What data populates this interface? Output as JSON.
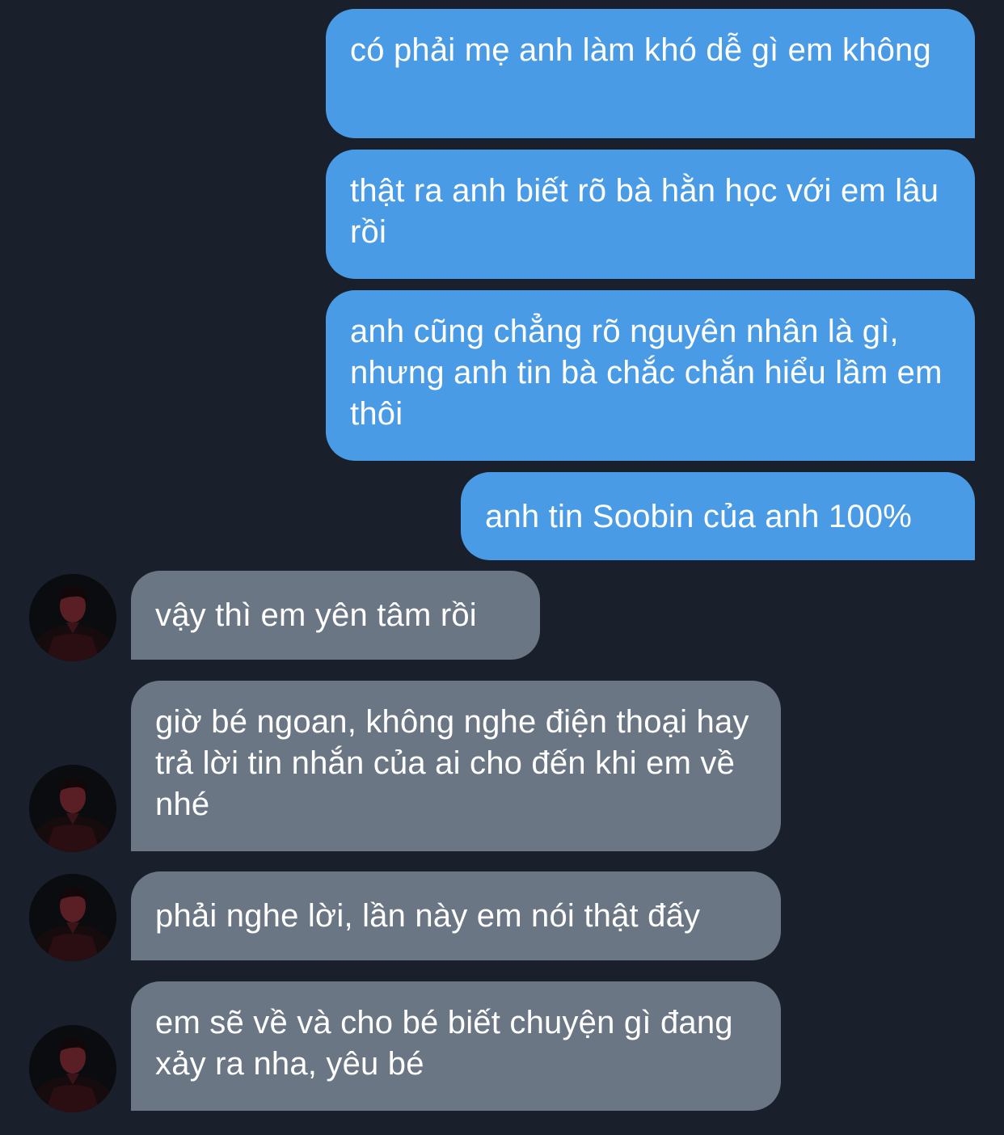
{
  "colors": {
    "background": "#1a202b",
    "sent_bubble": "#4a9be6",
    "received_bubble": "#6a7684",
    "text": "#ffffff"
  },
  "messages": [
    {
      "direction": "sent",
      "text": "có phải mẹ anh làm khó dễ gì em không"
    },
    {
      "direction": "sent",
      "text": "thật ra anh biết rõ bà hằn học với em lâu rồi"
    },
    {
      "direction": "sent",
      "text": "anh cũng chẳng rõ nguyên nhân là gì, nhưng anh tin bà chắc chắn hiểu lầm em thôi"
    },
    {
      "direction": "sent",
      "text": "anh tin Soobin của anh 100%"
    },
    {
      "direction": "received",
      "text": "vậy thì em yên tâm rồi",
      "avatar": "contact-avatar"
    },
    {
      "direction": "received",
      "text": "giờ bé ngoan, không nghe điện thoại hay trả lời tin nhắn của ai cho đến khi em về nhé",
      "avatar": "contact-avatar"
    },
    {
      "direction": "received",
      "text": "phải nghe lời, lần này em nói thật đấy",
      "avatar": "contact-avatar"
    },
    {
      "direction": "received",
      "text": "em sẽ về và cho bé biết chuyện gì đang xảy ra nha, yêu bé",
      "avatar": "contact-avatar"
    }
  ]
}
